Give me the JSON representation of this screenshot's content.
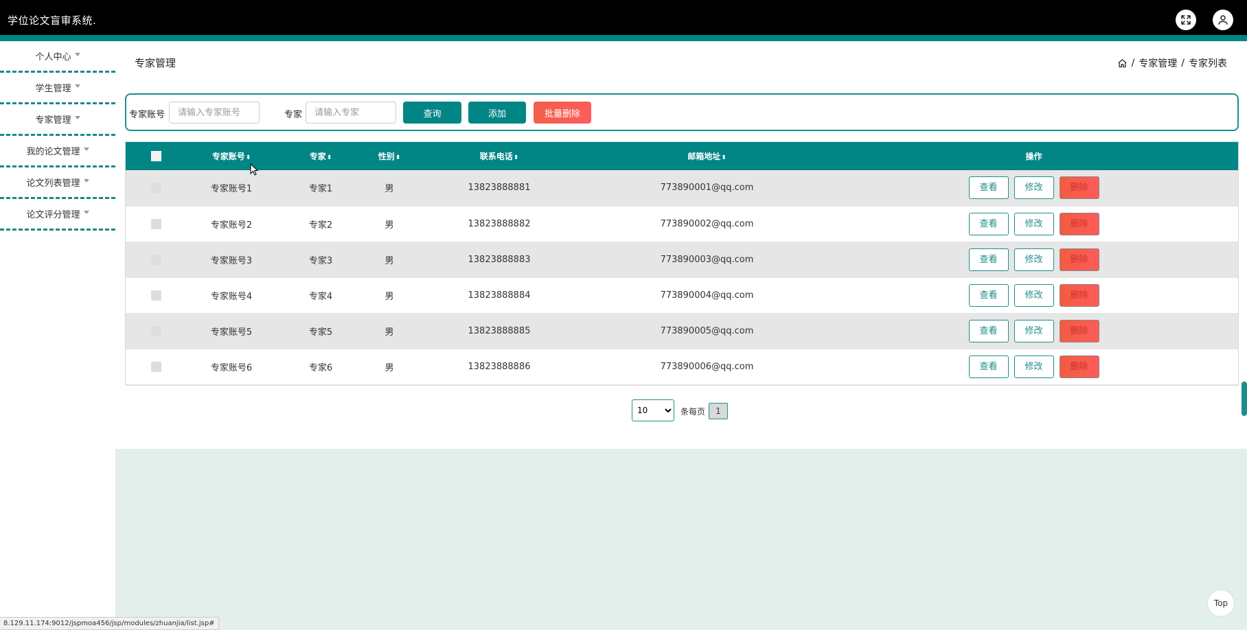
{
  "header": {
    "app_title": "学位论文盲审系统.",
    "fullscreen_icon": "fullscreen-icon",
    "user_icon": "user-icon"
  },
  "sidebar": {
    "items": [
      {
        "label": "个人中心"
      },
      {
        "label": "学生管理"
      },
      {
        "label": "专家管理"
      },
      {
        "label": "我的论文管理"
      },
      {
        "label": "论文列表管理"
      },
      {
        "label": "论文评分管理"
      }
    ]
  },
  "page": {
    "title": "专家管理",
    "breadcrumb": [
      "专家管理",
      "专家列表"
    ],
    "breadcrumb_sep": "/"
  },
  "search": {
    "account_label": "专家账号",
    "account_placeholder": "请输入专家账号",
    "expert_label": "专家",
    "expert_placeholder": "请输入专家",
    "query_button": "查询",
    "add_button": "添加",
    "batch_delete_button": "批量删除"
  },
  "table": {
    "columns": [
      "专家账号",
      "专家",
      "性别",
      "联系电话",
      "邮箱地址",
      "操作"
    ],
    "sort_glyph": "⬍",
    "rows": [
      {
        "account": "专家账号1",
        "name": "专家1",
        "gender": "男",
        "phone": "13823888881",
        "email": "773890001@qq.com"
      },
      {
        "account": "专家账号2",
        "name": "专家2",
        "gender": "男",
        "phone": "13823888882",
        "email": "773890002@qq.com"
      },
      {
        "account": "专家账号3",
        "name": "专家3",
        "gender": "男",
        "phone": "13823888883",
        "email": "773890003@qq.com"
      },
      {
        "account": "专家账号4",
        "name": "专家4",
        "gender": "男",
        "phone": "13823888884",
        "email": "773890004@qq.com"
      },
      {
        "account": "专家账号5",
        "name": "专家5",
        "gender": "男",
        "phone": "13823888885",
        "email": "773890005@qq.com"
      },
      {
        "account": "专家账号6",
        "name": "专家6",
        "gender": "男",
        "phone": "13823888886",
        "email": "773890006@qq.com"
      }
    ],
    "actions": {
      "view": "查看",
      "edit": "修改",
      "delete": "删除"
    }
  },
  "pagination": {
    "page_size": "10",
    "page_size_options": [
      "10"
    ],
    "per_page_label": "条每页",
    "current_page": "1"
  },
  "top_button": "Top",
  "status_url": "8.129.11.174:9012/jspmoa456/jsp/modules/zhuanjia/list.jsp#",
  "colors": {
    "primary": "#018585",
    "danger": "#ff5b5b",
    "content_bg": "#e3efeb"
  }
}
